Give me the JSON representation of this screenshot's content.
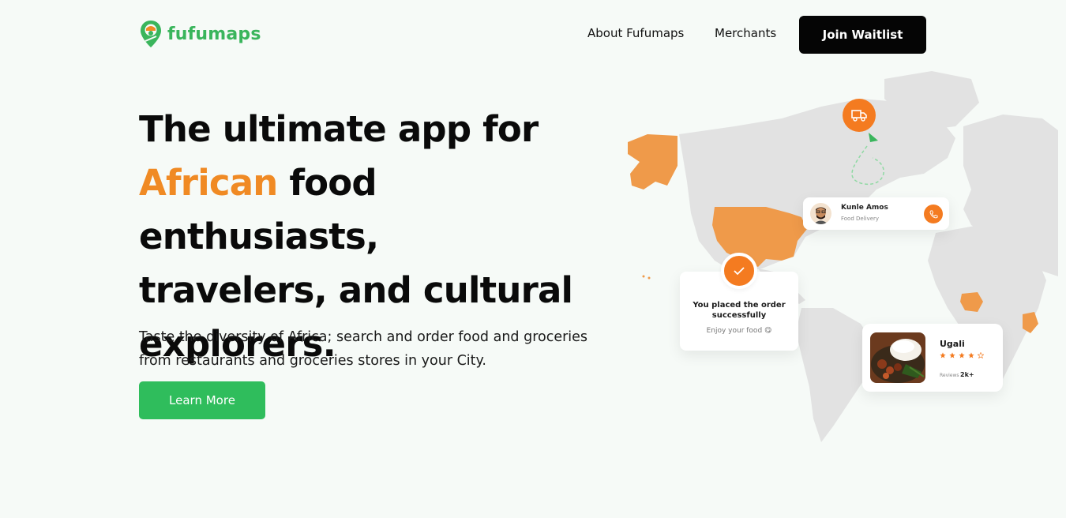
{
  "header": {
    "logo_text": "fufumaps",
    "nav": [
      {
        "label": "About Fufumaps"
      },
      {
        "label": "Merchants"
      }
    ],
    "cta_label": "Join Waitlist"
  },
  "hero": {
    "title_line1": "The ultimate app for",
    "title_accent": "African",
    "title_rest1": " food enthusiasts,",
    "title_line3": "travelers, and cultural",
    "title_line4": "explorers.",
    "subtitle": "Taste the diversity of Africa; search and order food and groceries from restaurants and groceries stores in your City.",
    "button_label": "Learn More"
  },
  "map_cards": {
    "courier": {
      "name": "Kunle Amos",
      "role": "Food Delivery"
    },
    "order": {
      "title": "You placed the order successfully",
      "subtitle": "Enjoy your food 😋"
    },
    "food": {
      "name": "Ugali",
      "rating": 4,
      "max_rating": 5,
      "reviews_label": "Reviews",
      "reviews_count": "2k+"
    }
  },
  "colors": {
    "brand_green": "#3ab55c",
    "button_green": "#2fbd5c",
    "accent_orange": "#f08a24",
    "map_orange": "#ef9a4a",
    "map_grey": "#e2e2e2"
  }
}
